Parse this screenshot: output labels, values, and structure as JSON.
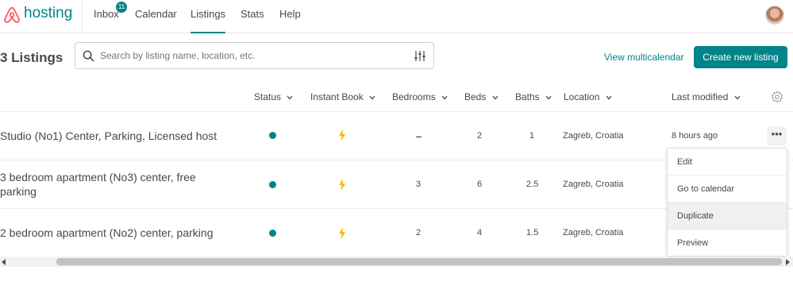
{
  "brand": {
    "name": "hosting",
    "logo_icon": "airbnb-belo-icon",
    "color": "#FF5A5F"
  },
  "nav": {
    "inbox": "Inbox",
    "inbox_badge": "11",
    "calendar": "Calendar",
    "listings": "Listings",
    "stats": "Stats",
    "help": "Help",
    "active": "Listings"
  },
  "header": {
    "title": "3 Listings",
    "search_placeholder": "Search by listing name, location, etc.",
    "multicalendar_link": "View multicalendar",
    "create_button": "Create new listing"
  },
  "columns": {
    "status": "Status",
    "instant_book": "Instant Book",
    "bedrooms": "Bedrooms",
    "beds": "Beds",
    "baths": "Baths",
    "location": "Location",
    "last_modified": "Last modified"
  },
  "rows": [
    {
      "name": "Studio (No1) Center, Parking, Licensed host",
      "status": "active",
      "instant_book": true,
      "bedrooms": "–",
      "beds": "2",
      "baths": "1",
      "location": "Zagreb, Croatia",
      "last_modified": "8 hours ago"
    },
    {
      "name": "3 bedroom apartment (No3) center, free parking",
      "name_line1": "3 bedroom apartment (No3) center, free",
      "name_line2": "parking",
      "status": "active",
      "instant_book": true,
      "bedrooms": "3",
      "beds": "6",
      "baths": "2.5",
      "location": "Zagreb, Croatia"
    },
    {
      "name": "2 bedroom apartment (No2) center, parking",
      "status": "active",
      "instant_book": true,
      "bedrooms": "2",
      "beds": "4",
      "baths": "1.5",
      "location": "Zagreb, Croatia"
    }
  ],
  "row_menu": {
    "more_label": "•••",
    "items": [
      "Edit",
      "Go to calendar",
      "Duplicate",
      "Preview"
    ],
    "highlighted": "Duplicate"
  },
  "colors": {
    "accent": "#008489",
    "bolt": "#FFB400",
    "text": "#484848"
  }
}
